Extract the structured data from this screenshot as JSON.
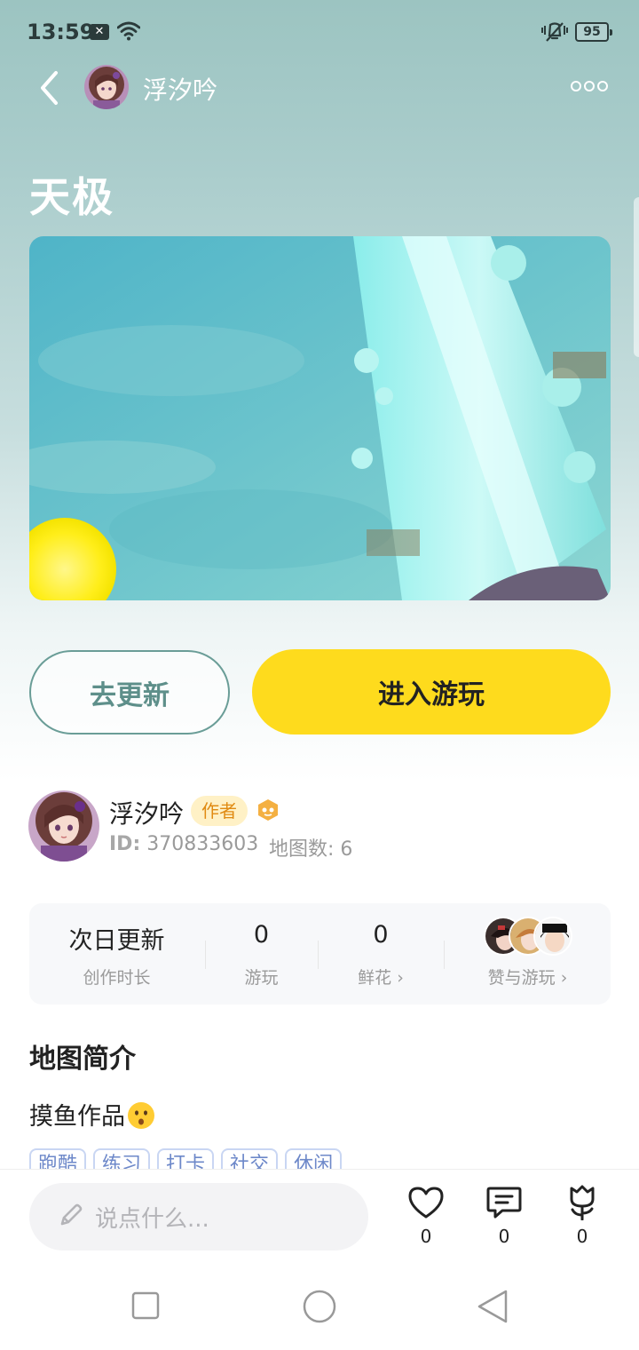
{
  "status_bar": {
    "time": "13:59",
    "x_badge": "✕",
    "battery": "95"
  },
  "header": {
    "author_name": "浮汐吟",
    "back_icon": "chevron-left-icon",
    "more_icon": "more-dots-icon"
  },
  "map": {
    "title": "天极"
  },
  "actions": {
    "update_label": "去更新",
    "play_label": "进入游玩"
  },
  "author": {
    "name": "浮汐吟",
    "badge": "作者",
    "id_label": "ID:",
    "id_value": "370833603",
    "maps_count": "地图数: 6"
  },
  "stats": {
    "update": {
      "value": "次日更新",
      "label": "创作时长"
    },
    "plays": {
      "value": "0",
      "label": "游玩"
    },
    "flowers": {
      "value": "0",
      "label": "鲜花"
    },
    "likes_label": "赞与游玩"
  },
  "intro": {
    "section_title": "地图简介",
    "text": "摸鱼作品",
    "tags": [
      "跑酷",
      "练习",
      "打卡",
      "社交",
      "休闲"
    ]
  },
  "bottom": {
    "comment_placeholder": "说点什么...",
    "like_count": "0",
    "comment_count": "0",
    "flower_count": "0"
  },
  "colors": {
    "accent_yellow": "#fedb1d",
    "teal_outline": "#6a9d97",
    "badge_orange": "#e08a12",
    "tag_blue": "#6d88c9"
  }
}
